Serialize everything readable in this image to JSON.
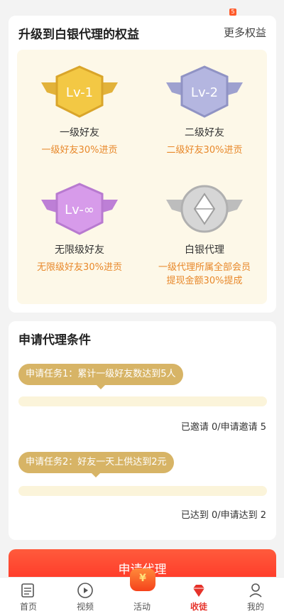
{
  "status": {
    "badge_count": "5"
  },
  "benefits": {
    "title": "升级到白银代理的权益",
    "more_label": "更多权益",
    "items": [
      {
        "badge_text": "Lv-1",
        "name": "一级好友",
        "desc": "一级好友30%进贡",
        "color": "#f0c43a"
      },
      {
        "badge_text": "Lv-2",
        "name": "二级好友",
        "desc": "二级好友30%进贡",
        "color": "#a9abd6"
      },
      {
        "badge_text": "Lv-∞",
        "name": "无限级好友",
        "desc": "无限级好友30%进贡",
        "color": "#cf8fe0"
      },
      {
        "badge_text": "",
        "name": "白银代理",
        "desc": "一级代理所属全部会员提现金额30%提成",
        "color": "#c8c8c8"
      }
    ]
  },
  "conditions": {
    "title": "申请代理条件",
    "tasks": [
      {
        "label": "申请任务1：累计一级好友数达到5人",
        "progress": 0,
        "status": "已邀请 0/申请邀请 5"
      },
      {
        "label": "申请任务2：好友一天上供达到2元",
        "progress": 0,
        "status": "已达到 0/申请达到 2"
      }
    ]
  },
  "apply_label": "申请代理",
  "tabs": [
    {
      "label": "首页",
      "icon": "news-icon",
      "active": false
    },
    {
      "label": "视频",
      "icon": "play-icon",
      "active": false
    },
    {
      "label": "活动",
      "icon": "redpacket-icon",
      "active": false
    },
    {
      "label": "收徒",
      "icon": "diamond-icon",
      "active": true
    },
    {
      "label": "我的",
      "icon": "user-icon",
      "active": false
    }
  ],
  "activity_symbol": "¥"
}
